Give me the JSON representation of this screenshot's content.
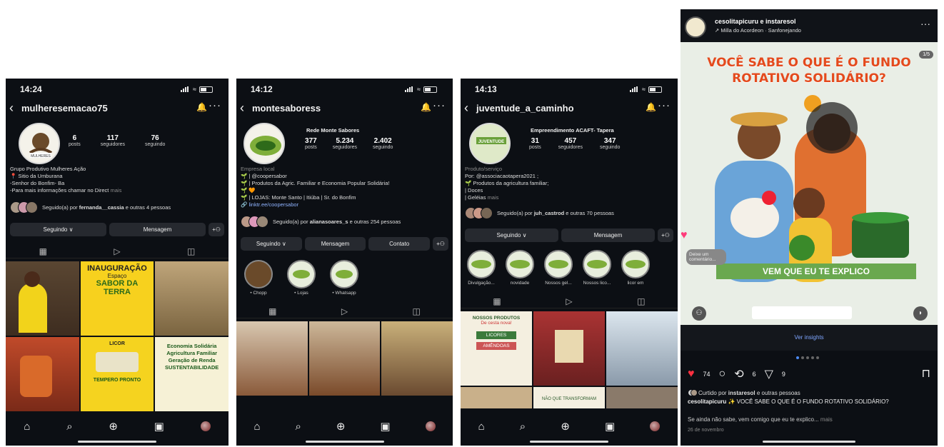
{
  "phones": [
    {
      "time": "14:24",
      "username": "mulheresemacao75",
      "stats": [
        {
          "value": "6",
          "label": "posts"
        },
        {
          "value": "117",
          "label": "seguidores"
        },
        {
          "value": "76",
          "label": "seguindo"
        }
      ],
      "bio": [
        "Grupo Produtivo Mulheres Ação",
        "📍 Sitio da Umburana",
        "-Senhor do Bonfim- Ba",
        "-Para mais informações chamar no Direct"
      ],
      "bio_more": "mais",
      "followed_by_prefix": "Seguido(a) por ",
      "followed_by": "fernanda__cassia",
      "followed_by_suffix": " e outras 4 pessoas",
      "buttons": [
        "Seguindo ∨",
        "Mensagem"
      ]
    },
    {
      "time": "14:12",
      "username": "montesaboress",
      "profile_name": "Rede Monte Sabores",
      "stats": [
        {
          "value": "377",
          "label": "posts"
        },
        {
          "value": "5.234",
          "label": "seguidores"
        },
        {
          "value": "2.402",
          "label": "seguindo"
        }
      ],
      "bio": [
        "Empresa local",
        "🌱 | @coopersabor",
        "🌱 | Produtos da Agric. Familiar e Economia Popular Solidária!",
        "🌱 🧡",
        "🌱 | LOJAS: Monte Santo | Itiúba | Sr. do Bonfim"
      ],
      "link": "linktr.ee/coopersabor",
      "followed_by_prefix": "Seguido(a) por ",
      "followed_by": "alianasoares_s",
      "followed_by_suffix": " e outras 254 pessoas",
      "buttons": [
        "Seguindo ∨",
        "Mensagem",
        "Contato"
      ],
      "highlights": [
        "Chopp",
        "Lojas",
        "Whatsapp"
      ]
    },
    {
      "time": "14:13",
      "username": "juventude_a_caminho",
      "profile_name": "Empreendimento ACAFT- Tapera",
      "stats": [
        {
          "value": "31",
          "label": "posts"
        },
        {
          "value": "457",
          "label": "seguidores"
        },
        {
          "value": "347",
          "label": "seguindo"
        }
      ],
      "bio": [
        "Produto/serviço",
        "Por: @associacaotapera2021 ;",
        "🌱 Produtos da agricultura familiar;",
        "| Doces",
        "| Geléias"
      ],
      "bio_more": "mais",
      "followed_by_prefix": "Seguido(a) por ",
      "followed_by": "juh_castrod",
      "followed_by_suffix": " e outras 70 pessoas",
      "buttons": [
        "Seguindo ∨",
        "Mensagem"
      ],
      "highlights": [
        "Divulgação...",
        "novidade",
        "Nossos gel...",
        "Nossos lico...",
        "licor em"
      ]
    }
  ],
  "grid1": {
    "inauguracao": "INAUGURAÇÃO",
    "espaco": "Espaço",
    "sabor": "SABOR DA",
    "terra": "TERRA",
    "economia": "Economia Solidária",
    "agricultura": "Agricultura Familiar",
    "geracao": "Geração de Renda",
    "sustent": "SUSTENTABILIDADE",
    "licor": "LICOR",
    "tempero": "TEMPERO PRONTO"
  },
  "grid3": {
    "nossos": "NOSSOS PRODUTOS",
    "cesta": "De cesta nova!",
    "licores": "LICORES",
    "amendoas": "AMÊNDOAS",
    "mude": "NÃO QUE TRANSFORMAM"
  },
  "post": {
    "user": "cesolitapicuru e instaresol",
    "music": "Milla do Acordeon · Sanfonejando",
    "headline": "VOCÊ SABE O QUE É O FUNDO ROTATIVO SOLIDÁRIO?",
    "counter": "1/5",
    "cta": "VEM QUE EU TE EXPLICO",
    "comment_hint": "Deixe um comentário...",
    "insights": "Ver insights",
    "likes": "74",
    "comments": "6",
    "shares": "9",
    "liked_by_prefix": "Curtido por ",
    "liked_by": "instaresol",
    "liked_by_suffix": " e outras pessoas",
    "caption_user": "cesolitapicuru",
    "caption": "✨ VOCÊ SABE O QUE É O FUNDO ROTATIVO SOLIDÁRIO?",
    "caption2": "Se ainda não sabe, vem comigo que eu te explico...",
    "caption_more": "mais",
    "date": "26 de novembro",
    "colors": {
      "headline": "#e44a1d",
      "link": "#7fa6ff",
      "heart": "#ff3040"
    }
  }
}
